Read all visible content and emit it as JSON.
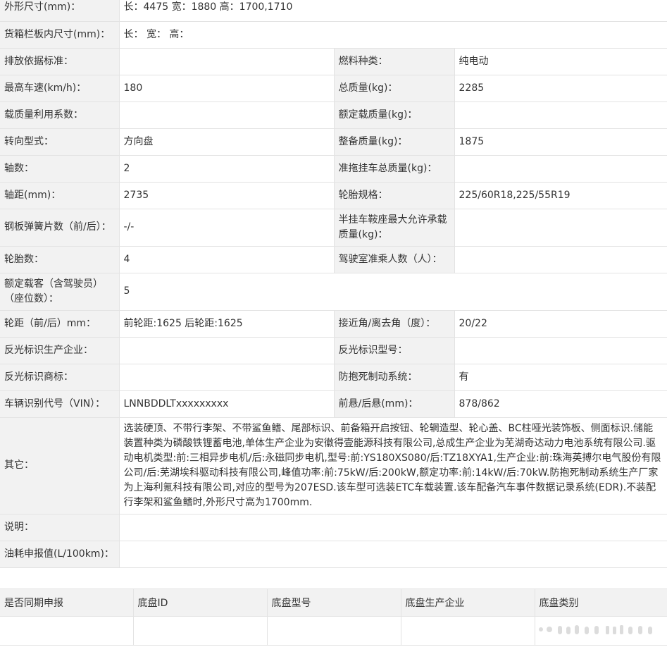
{
  "rows": [
    {
      "l": "外形尺寸(mm)：",
      "v": "长：4475 宽：1880 高：1700,1710",
      "span": true
    },
    {
      "l": "货箱栏板内尺寸(mm)：",
      "v": "长：  宽：  高：",
      "span": true
    },
    {
      "l": "排放依据标准：",
      "v": "",
      "l2": "燃料种类：",
      "v2": "纯电动"
    },
    {
      "l": "最高车速(km/h)：",
      "v": "180",
      "l2": "总质量(kg)：",
      "v2": "2285"
    },
    {
      "l": "载质量利用系数：",
      "v": "",
      "l2": "额定载质量(kg)：",
      "v2": ""
    },
    {
      "l": "转向型式：",
      "v": "方向盘",
      "l2": "整备质量(kg)：",
      "v2": "1875"
    },
    {
      "l": "轴数：",
      "v": "2",
      "l2": "准拖挂车总质量(kg)：",
      "v2": ""
    },
    {
      "l": "轴距(mm)：",
      "v": "2735",
      "l2": "轮胎规格：",
      "v2": "225/60R18,225/55R19"
    },
    {
      "l": "钢板弹簧片数（前/后）：",
      "v": "-/-",
      "l2": "半挂车鞍座最大允许承载质量(kg)：",
      "v2": ""
    },
    {
      "l": "轮胎数：",
      "v": "4",
      "l2": "驾驶室准乘人数（人）：",
      "v2": ""
    },
    {
      "l": "额定载客（含驾驶员）（座位数）：",
      "v": "5",
      "span": true
    },
    {
      "l": "轮距（前/后）mm：",
      "v": "前轮距:1625 后轮距:1625",
      "l2": "接近角/离去角（度）：",
      "v2": "20/22"
    },
    {
      "l": "反光标识生产企业：",
      "v": "",
      "l2": "反光标识型号：",
      "v2": ""
    },
    {
      "l": "反光标识商标：",
      "v": "",
      "l2": "防抱死制动系统：",
      "v2": "有"
    },
    {
      "l": "车辆识别代号（VIN）：",
      "v": "LNNBDDLTxxxxxxxxx",
      "l2": "前悬/后悬(mm)：",
      "v2": "878/862"
    },
    {
      "l": "其它：",
      "v": "选装硬顶、不带行李架、不带鲨鱼鳍、尾部标识、前备箱开启按钮、轮辋造型、轮心盖、BC柱哑光装饰板、侧面标识.储能装置种类为磷酸铁锂蓄电池,单体生产企业为安徽得壹能源科技有限公司,总成生产企业为芜湖奇达动力电池系统有限公司.驱动电机类型:前:三相异步电机/后:永磁同步电机,型号:前:YS180XS080/后:TZ18XYA1,生产企业:前:珠海英搏尔电气股份有限公司/后:芜湖埃科驱动科技有限公司,峰值功率:前:75kW/后:200kW,额定功率:前:14kW/后:70kW.防抱死制动系统生产厂家为上海利氪科技有限公司,对应的型号为207ESD.该车型可选装ETC车载装置.该车配备汽车事件数据记录系统(EDR).不装配行李架和鲨鱼鳍时,外形尺寸高为1700mm.",
      "span": true
    },
    {
      "l": "说明：",
      "v": "",
      "span": true
    },
    {
      "l": "油耗申报值(L/100km)：",
      "v": "",
      "span": true
    }
  ],
  "bottom": {
    "headers": [
      "是否同期申报",
      "底盘ID",
      "底盘型号",
      "底盘生产企业",
      "底盘类别"
    ]
  }
}
